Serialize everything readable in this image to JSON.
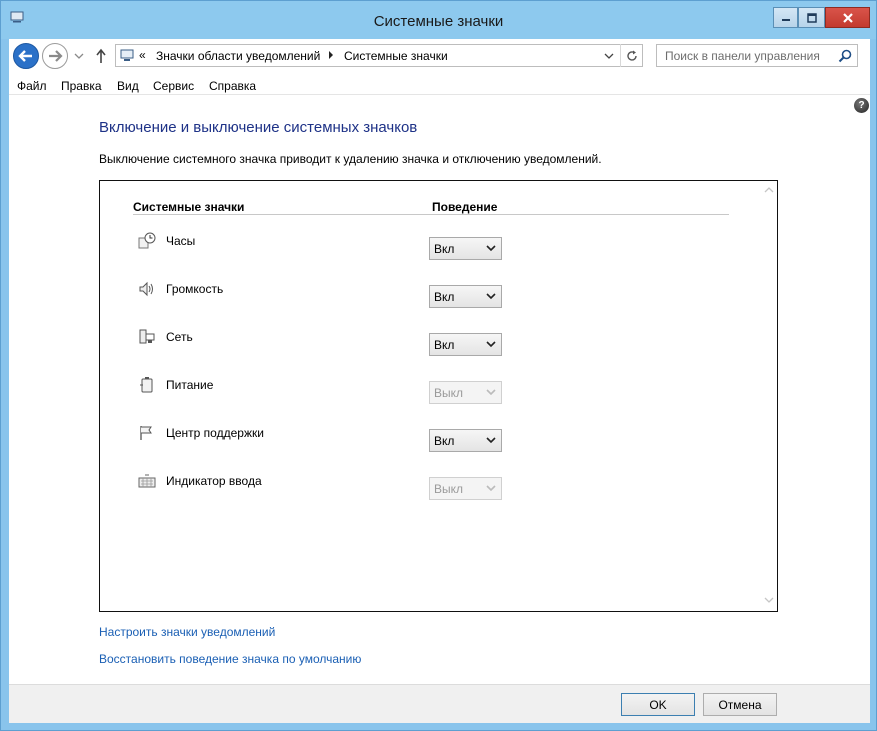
{
  "window": {
    "title": "Системные значки"
  },
  "navbar": {
    "breadcrumbs": [
      "«",
      "Значки области уведомлений",
      "Системные значки"
    ],
    "search_placeholder": "Поиск в панели управления"
  },
  "menu": [
    "Файл",
    "Правка",
    "Вид",
    "Сервис",
    "Справка"
  ],
  "main": {
    "heading": "Включение и выключение системных значков",
    "description": "Выключение системного значка приводит к удалению значка и отключению уведомлений.",
    "table": {
      "headers": [
        "Системные значки",
        "Поведение"
      ],
      "rows": [
        {
          "label": "Часы",
          "icon": "clock-icon",
          "value": "Вкл",
          "enabled": true
        },
        {
          "label": "Громкость",
          "icon": "volume-icon",
          "value": "Вкл",
          "enabled": true
        },
        {
          "label": "Сеть",
          "icon": "network-icon",
          "value": "Вкл",
          "enabled": true
        },
        {
          "label": "Питание",
          "icon": "power-icon",
          "value": "Выкл",
          "enabled": false
        },
        {
          "label": "Центр поддержки",
          "icon": "flag-icon",
          "value": "Вкл",
          "enabled": true
        },
        {
          "label": "Индикатор ввода",
          "icon": "keyboard-icon",
          "value": "Выкл",
          "enabled": false
        }
      ]
    },
    "links": [
      "Настроить значки уведомлений",
      "Восстановить поведение значка по умолчанию"
    ]
  },
  "footer": {
    "ok_label": "OK",
    "cancel_label": "Отмена"
  },
  "colors": {
    "titlebar": "#8dc9ee",
    "heading": "#1e3287",
    "link": "#1a5fb4",
    "back_button": "#2b71c8"
  }
}
